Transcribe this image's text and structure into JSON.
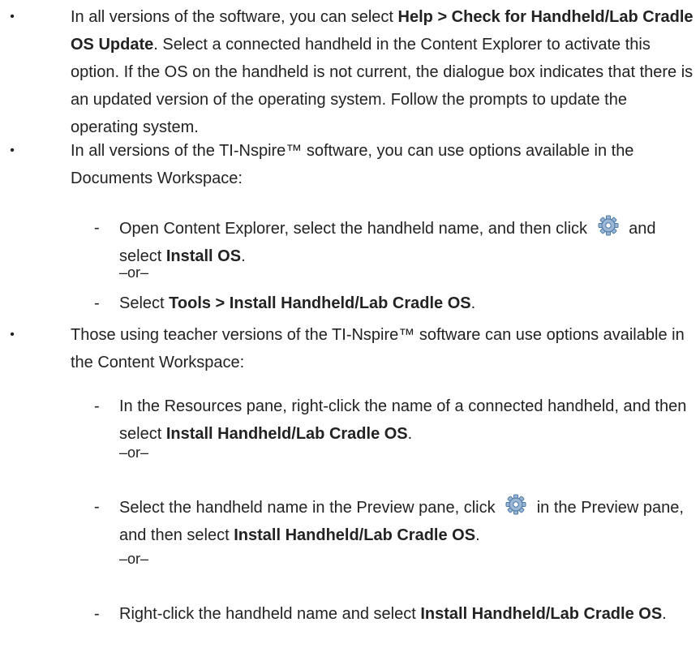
{
  "colors": {
    "text": "#222222",
    "gear_fill": "#9bb7d4",
    "gear_stroke": "#4a78a8"
  },
  "icons": {
    "gear": "gear-icon"
  },
  "bullets": {
    "b1": {
      "a": "In all versions of the software, you can select ",
      "bold1": "Help > Check for Handheld/Lab Cradle OS Update",
      "b": ". Select a connected handheld in the Content Explorer to activate this option. If the OS on the handheld is not current, the dialogue box indicates that there is an updated version of the operating system. Follow the prompts to update the operating system."
    },
    "b2": {
      "text": "In all versions of the TI-Nspire™ software, you can use options available in the Documents Workspace:",
      "s1": {
        "a": "Open Content Explorer, select the handheld name, and then click ",
        "b": " and select ",
        "bold": "Install OS",
        "c": "."
      },
      "or1": "–or–",
      "s2": {
        "a": "Select ",
        "bold": "Tools > Install Handheld/Lab Cradle OS",
        "b": "."
      }
    },
    "b3": {
      "text": "Those using teacher versions of the TI-Nspire™ software can use options available in the Content Workspace:",
      "s1": {
        "a": "In the Resources pane, right-click the name of a connected handheld, and then select ",
        "bold": "Install Handheld/Lab Cradle OS",
        "b": "."
      },
      "or1": "–or–",
      "s2": {
        "a": "Select the handheld name in the Preview pane, click ",
        "b": " in the Preview pane, and then select ",
        "bold": "Install Handheld/Lab Cradle OS",
        "c": "."
      },
      "or2": "–or–",
      "s3": {
        "a": "Right-click the handheld name and select ",
        "bold": "Install Handheld/Lab Cradle OS",
        "b": "."
      }
    }
  },
  "markers": {
    "bullet": "•",
    "dash": "-"
  }
}
